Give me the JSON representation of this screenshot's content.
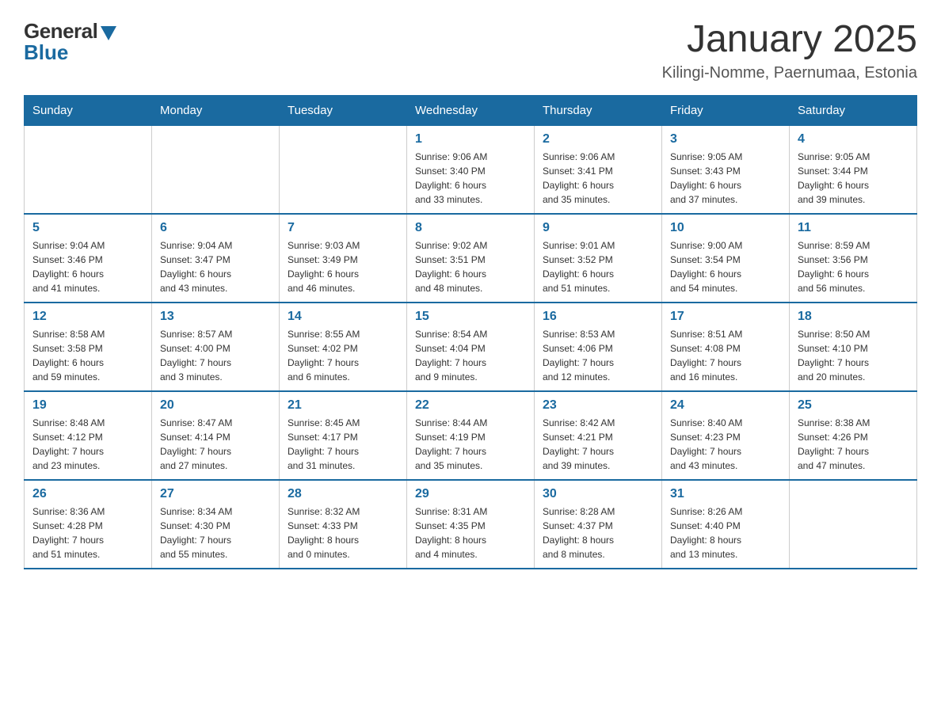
{
  "logo": {
    "general": "General",
    "blue": "Blue"
  },
  "header": {
    "title": "January 2025",
    "location": "Kilingi-Nomme, Paernumaa, Estonia"
  },
  "weekdays": [
    "Sunday",
    "Monday",
    "Tuesday",
    "Wednesday",
    "Thursday",
    "Friday",
    "Saturday"
  ],
  "weeks": [
    [
      {
        "day": "",
        "info": ""
      },
      {
        "day": "",
        "info": ""
      },
      {
        "day": "",
        "info": ""
      },
      {
        "day": "1",
        "info": "Sunrise: 9:06 AM\nSunset: 3:40 PM\nDaylight: 6 hours\nand 33 minutes."
      },
      {
        "day": "2",
        "info": "Sunrise: 9:06 AM\nSunset: 3:41 PM\nDaylight: 6 hours\nand 35 minutes."
      },
      {
        "day": "3",
        "info": "Sunrise: 9:05 AM\nSunset: 3:43 PM\nDaylight: 6 hours\nand 37 minutes."
      },
      {
        "day": "4",
        "info": "Sunrise: 9:05 AM\nSunset: 3:44 PM\nDaylight: 6 hours\nand 39 minutes."
      }
    ],
    [
      {
        "day": "5",
        "info": "Sunrise: 9:04 AM\nSunset: 3:46 PM\nDaylight: 6 hours\nand 41 minutes."
      },
      {
        "day": "6",
        "info": "Sunrise: 9:04 AM\nSunset: 3:47 PM\nDaylight: 6 hours\nand 43 minutes."
      },
      {
        "day": "7",
        "info": "Sunrise: 9:03 AM\nSunset: 3:49 PM\nDaylight: 6 hours\nand 46 minutes."
      },
      {
        "day": "8",
        "info": "Sunrise: 9:02 AM\nSunset: 3:51 PM\nDaylight: 6 hours\nand 48 minutes."
      },
      {
        "day": "9",
        "info": "Sunrise: 9:01 AM\nSunset: 3:52 PM\nDaylight: 6 hours\nand 51 minutes."
      },
      {
        "day": "10",
        "info": "Sunrise: 9:00 AM\nSunset: 3:54 PM\nDaylight: 6 hours\nand 54 minutes."
      },
      {
        "day": "11",
        "info": "Sunrise: 8:59 AM\nSunset: 3:56 PM\nDaylight: 6 hours\nand 56 minutes."
      }
    ],
    [
      {
        "day": "12",
        "info": "Sunrise: 8:58 AM\nSunset: 3:58 PM\nDaylight: 6 hours\nand 59 minutes."
      },
      {
        "day": "13",
        "info": "Sunrise: 8:57 AM\nSunset: 4:00 PM\nDaylight: 7 hours\nand 3 minutes."
      },
      {
        "day": "14",
        "info": "Sunrise: 8:55 AM\nSunset: 4:02 PM\nDaylight: 7 hours\nand 6 minutes."
      },
      {
        "day": "15",
        "info": "Sunrise: 8:54 AM\nSunset: 4:04 PM\nDaylight: 7 hours\nand 9 minutes."
      },
      {
        "day": "16",
        "info": "Sunrise: 8:53 AM\nSunset: 4:06 PM\nDaylight: 7 hours\nand 12 minutes."
      },
      {
        "day": "17",
        "info": "Sunrise: 8:51 AM\nSunset: 4:08 PM\nDaylight: 7 hours\nand 16 minutes."
      },
      {
        "day": "18",
        "info": "Sunrise: 8:50 AM\nSunset: 4:10 PM\nDaylight: 7 hours\nand 20 minutes."
      }
    ],
    [
      {
        "day": "19",
        "info": "Sunrise: 8:48 AM\nSunset: 4:12 PM\nDaylight: 7 hours\nand 23 minutes."
      },
      {
        "day": "20",
        "info": "Sunrise: 8:47 AM\nSunset: 4:14 PM\nDaylight: 7 hours\nand 27 minutes."
      },
      {
        "day": "21",
        "info": "Sunrise: 8:45 AM\nSunset: 4:17 PM\nDaylight: 7 hours\nand 31 minutes."
      },
      {
        "day": "22",
        "info": "Sunrise: 8:44 AM\nSunset: 4:19 PM\nDaylight: 7 hours\nand 35 minutes."
      },
      {
        "day": "23",
        "info": "Sunrise: 8:42 AM\nSunset: 4:21 PM\nDaylight: 7 hours\nand 39 minutes."
      },
      {
        "day": "24",
        "info": "Sunrise: 8:40 AM\nSunset: 4:23 PM\nDaylight: 7 hours\nand 43 minutes."
      },
      {
        "day": "25",
        "info": "Sunrise: 8:38 AM\nSunset: 4:26 PM\nDaylight: 7 hours\nand 47 minutes."
      }
    ],
    [
      {
        "day": "26",
        "info": "Sunrise: 8:36 AM\nSunset: 4:28 PM\nDaylight: 7 hours\nand 51 minutes."
      },
      {
        "day": "27",
        "info": "Sunrise: 8:34 AM\nSunset: 4:30 PM\nDaylight: 7 hours\nand 55 minutes."
      },
      {
        "day": "28",
        "info": "Sunrise: 8:32 AM\nSunset: 4:33 PM\nDaylight: 8 hours\nand 0 minutes."
      },
      {
        "day": "29",
        "info": "Sunrise: 8:31 AM\nSunset: 4:35 PM\nDaylight: 8 hours\nand 4 minutes."
      },
      {
        "day": "30",
        "info": "Sunrise: 8:28 AM\nSunset: 4:37 PM\nDaylight: 8 hours\nand 8 minutes."
      },
      {
        "day": "31",
        "info": "Sunrise: 8:26 AM\nSunset: 4:40 PM\nDaylight: 8 hours\nand 13 minutes."
      },
      {
        "day": "",
        "info": ""
      }
    ]
  ]
}
